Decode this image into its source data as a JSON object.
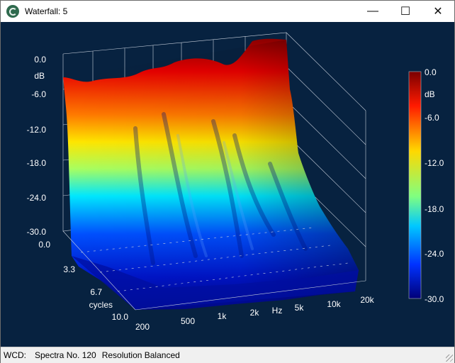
{
  "window": {
    "title": "Waterfall: 5"
  },
  "controls": {
    "minimize": "—",
    "maximize": "☐",
    "close": "✕"
  },
  "plot": {
    "z_unit": "dB",
    "z_ticks": [
      "0.0",
      "-6.0",
      "-12.0",
      "-18.0",
      "-24.0",
      "-30.0"
    ],
    "y_unit": "cycles",
    "y_ticks": [
      "0.0",
      "3.3",
      "6.7",
      "10.0"
    ],
    "x_unit": "Hz",
    "x_ticks": [
      "200",
      "500",
      "1k",
      "2k",
      "5k",
      "10k",
      "20k"
    ],
    "colorbar": {
      "unit": "dB",
      "ticks": [
        "0.0",
        "-6.0",
        "-12.0",
        "-18.0",
        "-24.0",
        "-30.0"
      ],
      "colors": [
        "#7a0000",
        "#ff1a00",
        "#ffd800",
        "#80ff80",
        "#00c8ff",
        "#0032ff",
        "#000078"
      ]
    }
  },
  "status": {
    "label": "WCD:",
    "spectra": "Spectra No. 120",
    "resolution": "Resolution Balanced"
  }
}
